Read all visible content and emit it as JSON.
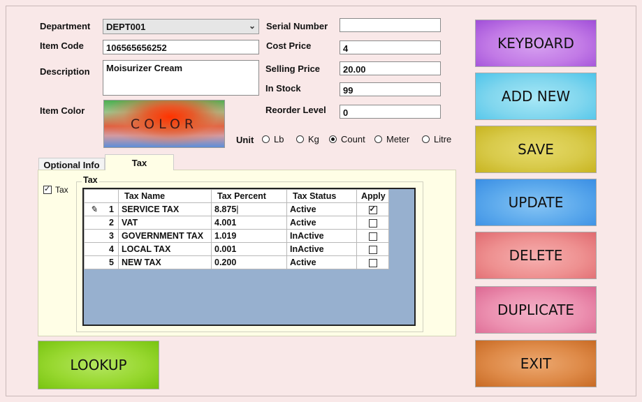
{
  "form": {
    "department_label": "Department",
    "department_value": "DEPT001",
    "item_code_label": "Item Code",
    "item_code_value": "106565656252",
    "description_label": "Description",
    "description_value": "Moisurizer Cream",
    "item_color_label": "Item Color",
    "color_button_label": "COLOR",
    "serial_number_label": "Serial Number",
    "serial_number_value": "",
    "cost_price_label": "Cost Price",
    "cost_price_value": "4",
    "selling_price_label": "Selling Price",
    "selling_price_value": "20.00",
    "in_stock_label": "In Stock",
    "in_stock_value": "99",
    "reorder_level_label": "Reorder Level",
    "reorder_level_value": "0",
    "unit_label": "Unit",
    "unit_options": [
      "Lb",
      "Kg",
      "Count",
      "Meter",
      "Litre"
    ],
    "unit_selected": "Count"
  },
  "tabs": {
    "optional_info": "Optional Info",
    "tax": "Tax",
    "active": "Tax"
  },
  "tax_panel": {
    "checkbox_label": "Tax",
    "checkbox_checked": true,
    "group_title": "Tax",
    "columns": [
      "Tax Name",
      "Tax Percent",
      "Tax Status",
      "Apply"
    ],
    "rows": [
      {
        "num": "1",
        "name": "SERVICE TAX",
        "percent": "8.875",
        "status": "Active",
        "apply": true
      },
      {
        "num": "2",
        "name": "VAT",
        "percent": "4.001",
        "status": "Active",
        "apply": false
      },
      {
        "num": "3",
        "name": "GOVERNMENT TAX",
        "percent": "1.019",
        "status": "InActive",
        "apply": false
      },
      {
        "num": "4",
        "name": "LOCAL TAX",
        "percent": "0.001",
        "status": "InActive",
        "apply": false
      },
      {
        "num": "5",
        "name": "NEW TAX",
        "percent": "0.200",
        "status": "Active",
        "apply": false
      }
    ]
  },
  "buttons": {
    "keyboard": "KEYBOARD",
    "add_new": "ADD NEW",
    "save": "SAVE",
    "update": "UPDATE",
    "delete": "DELETE",
    "duplicate": "DUPLICATE",
    "exit": "EXIT",
    "lookup": "LOOKUP"
  },
  "colors": {
    "background": "#f9e8e8",
    "keyboard": "#c77ee8",
    "add_new": "#7fd6ee",
    "save": "#d4c43a",
    "update": "#4aa3e8",
    "delete": "#ee8c8c",
    "duplicate": "#ec8cb0",
    "exit": "#dc8444",
    "lookup": "#8cd41e",
    "grid_background": "#97b0cf",
    "tax_panel": "#fffee6"
  }
}
